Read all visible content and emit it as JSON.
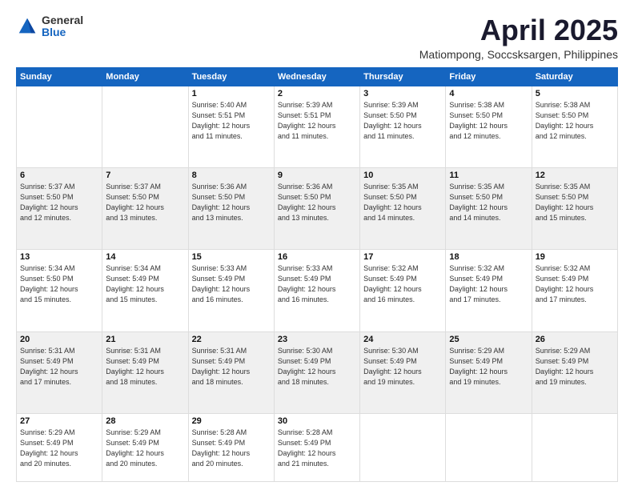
{
  "logo": {
    "general": "General",
    "blue": "Blue"
  },
  "header": {
    "title": "April 2025",
    "subtitle": "Matiompong, Soccsksargen, Philippines"
  },
  "weekdays": [
    "Sunday",
    "Monday",
    "Tuesday",
    "Wednesday",
    "Thursday",
    "Friday",
    "Saturday"
  ],
  "weeks": [
    [
      {
        "day": "",
        "info": ""
      },
      {
        "day": "",
        "info": ""
      },
      {
        "day": "1",
        "info": "Sunrise: 5:40 AM\nSunset: 5:51 PM\nDaylight: 12 hours\nand 11 minutes."
      },
      {
        "day": "2",
        "info": "Sunrise: 5:39 AM\nSunset: 5:51 PM\nDaylight: 12 hours\nand 11 minutes."
      },
      {
        "day": "3",
        "info": "Sunrise: 5:39 AM\nSunset: 5:50 PM\nDaylight: 12 hours\nand 11 minutes."
      },
      {
        "day": "4",
        "info": "Sunrise: 5:38 AM\nSunset: 5:50 PM\nDaylight: 12 hours\nand 12 minutes."
      },
      {
        "day": "5",
        "info": "Sunrise: 5:38 AM\nSunset: 5:50 PM\nDaylight: 12 hours\nand 12 minutes."
      }
    ],
    [
      {
        "day": "6",
        "info": "Sunrise: 5:37 AM\nSunset: 5:50 PM\nDaylight: 12 hours\nand 12 minutes."
      },
      {
        "day": "7",
        "info": "Sunrise: 5:37 AM\nSunset: 5:50 PM\nDaylight: 12 hours\nand 13 minutes."
      },
      {
        "day": "8",
        "info": "Sunrise: 5:36 AM\nSunset: 5:50 PM\nDaylight: 12 hours\nand 13 minutes."
      },
      {
        "day": "9",
        "info": "Sunrise: 5:36 AM\nSunset: 5:50 PM\nDaylight: 12 hours\nand 13 minutes."
      },
      {
        "day": "10",
        "info": "Sunrise: 5:35 AM\nSunset: 5:50 PM\nDaylight: 12 hours\nand 14 minutes."
      },
      {
        "day": "11",
        "info": "Sunrise: 5:35 AM\nSunset: 5:50 PM\nDaylight: 12 hours\nand 14 minutes."
      },
      {
        "day": "12",
        "info": "Sunrise: 5:35 AM\nSunset: 5:50 PM\nDaylight: 12 hours\nand 15 minutes."
      }
    ],
    [
      {
        "day": "13",
        "info": "Sunrise: 5:34 AM\nSunset: 5:50 PM\nDaylight: 12 hours\nand 15 minutes."
      },
      {
        "day": "14",
        "info": "Sunrise: 5:34 AM\nSunset: 5:49 PM\nDaylight: 12 hours\nand 15 minutes."
      },
      {
        "day": "15",
        "info": "Sunrise: 5:33 AM\nSunset: 5:49 PM\nDaylight: 12 hours\nand 16 minutes."
      },
      {
        "day": "16",
        "info": "Sunrise: 5:33 AM\nSunset: 5:49 PM\nDaylight: 12 hours\nand 16 minutes."
      },
      {
        "day": "17",
        "info": "Sunrise: 5:32 AM\nSunset: 5:49 PM\nDaylight: 12 hours\nand 16 minutes."
      },
      {
        "day": "18",
        "info": "Sunrise: 5:32 AM\nSunset: 5:49 PM\nDaylight: 12 hours\nand 17 minutes."
      },
      {
        "day": "19",
        "info": "Sunrise: 5:32 AM\nSunset: 5:49 PM\nDaylight: 12 hours\nand 17 minutes."
      }
    ],
    [
      {
        "day": "20",
        "info": "Sunrise: 5:31 AM\nSunset: 5:49 PM\nDaylight: 12 hours\nand 17 minutes."
      },
      {
        "day": "21",
        "info": "Sunrise: 5:31 AM\nSunset: 5:49 PM\nDaylight: 12 hours\nand 18 minutes."
      },
      {
        "day": "22",
        "info": "Sunrise: 5:31 AM\nSunset: 5:49 PM\nDaylight: 12 hours\nand 18 minutes."
      },
      {
        "day": "23",
        "info": "Sunrise: 5:30 AM\nSunset: 5:49 PM\nDaylight: 12 hours\nand 18 minutes."
      },
      {
        "day": "24",
        "info": "Sunrise: 5:30 AM\nSunset: 5:49 PM\nDaylight: 12 hours\nand 19 minutes."
      },
      {
        "day": "25",
        "info": "Sunrise: 5:29 AM\nSunset: 5:49 PM\nDaylight: 12 hours\nand 19 minutes."
      },
      {
        "day": "26",
        "info": "Sunrise: 5:29 AM\nSunset: 5:49 PM\nDaylight: 12 hours\nand 19 minutes."
      }
    ],
    [
      {
        "day": "27",
        "info": "Sunrise: 5:29 AM\nSunset: 5:49 PM\nDaylight: 12 hours\nand 20 minutes."
      },
      {
        "day": "28",
        "info": "Sunrise: 5:29 AM\nSunset: 5:49 PM\nDaylight: 12 hours\nand 20 minutes."
      },
      {
        "day": "29",
        "info": "Sunrise: 5:28 AM\nSunset: 5:49 PM\nDaylight: 12 hours\nand 20 minutes."
      },
      {
        "day": "30",
        "info": "Sunrise: 5:28 AM\nSunset: 5:49 PM\nDaylight: 12 hours\nand 21 minutes."
      },
      {
        "day": "",
        "info": ""
      },
      {
        "day": "",
        "info": ""
      },
      {
        "day": "",
        "info": ""
      }
    ]
  ]
}
